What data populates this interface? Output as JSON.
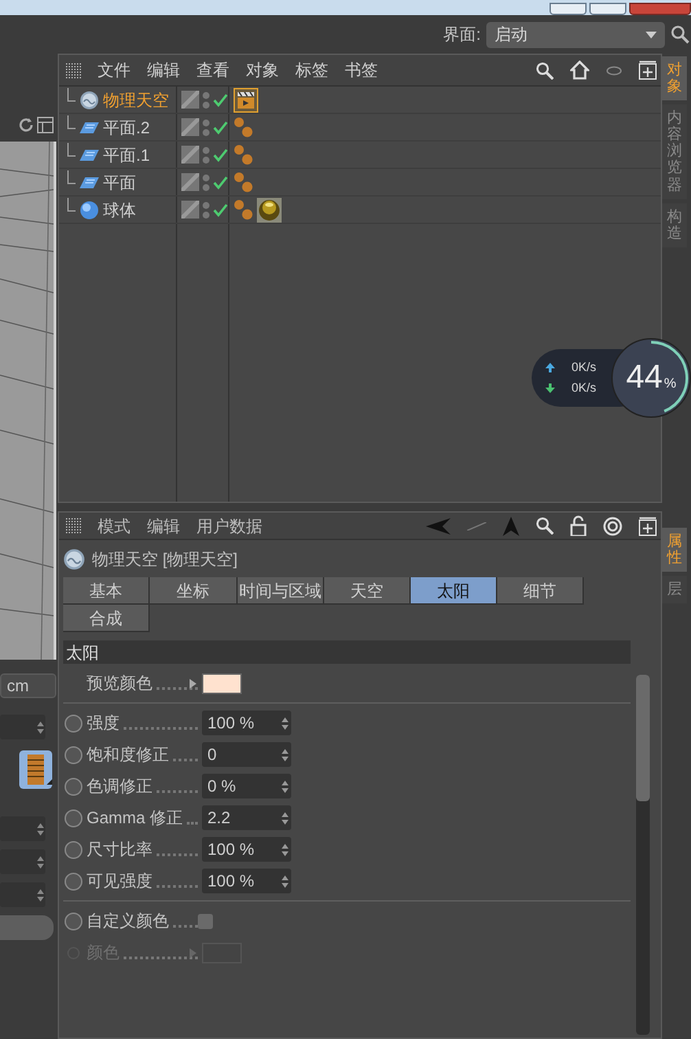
{
  "interface": {
    "label": "界面:",
    "value": "启动"
  },
  "left_panel": {
    "unit": "cm"
  },
  "object_manager": {
    "menu": [
      "文件",
      "编辑",
      "查看",
      "对象",
      "标签",
      "书签"
    ],
    "objects": [
      {
        "name": "物理天空",
        "kind": "sky",
        "selected": true,
        "enabled": true,
        "tags": [
          {
            "kind": "clapper"
          }
        ]
      },
      {
        "name": "平面.2",
        "kind": "plane",
        "selected": false,
        "enabled": true,
        "tags": [
          {
            "kind": "phong"
          }
        ]
      },
      {
        "name": "平面.1",
        "kind": "plane",
        "selected": false,
        "enabled": true,
        "tags": [
          {
            "kind": "phong"
          }
        ]
      },
      {
        "name": "平面",
        "kind": "plane",
        "selected": false,
        "enabled": true,
        "tags": [
          {
            "kind": "phong"
          }
        ]
      },
      {
        "name": "球体",
        "kind": "sphere",
        "selected": false,
        "enabled": true,
        "tags": [
          {
            "kind": "phong"
          },
          {
            "kind": "material"
          }
        ]
      }
    ]
  },
  "side_tabs_top": [
    {
      "label": "对象",
      "selected": true
    },
    {
      "label": "内容浏览器",
      "selected": false
    },
    {
      "label": "构造",
      "selected": false
    }
  ],
  "side_tabs_bottom": [
    {
      "label": "属性",
      "selected": true
    },
    {
      "label": "层",
      "selected": false
    }
  ],
  "speed_meter": {
    "upload": "0K/s",
    "download": "0K/s",
    "percent": "44",
    "unit": "%",
    "level": 0.44
  },
  "attributes": {
    "menu": [
      "模式",
      "编辑",
      "用户数据"
    ],
    "title": "物理天空 [物理天空]",
    "tabs": [
      {
        "label": "基本",
        "selected": false
      },
      {
        "label": "坐标",
        "selected": false
      },
      {
        "label": "时间与区域",
        "selected": false
      },
      {
        "label": "天空",
        "selected": false
      },
      {
        "label": "太阳",
        "selected": true
      },
      {
        "label": "细节",
        "selected": false
      },
      {
        "label": "合成",
        "selected": false
      }
    ],
    "section": "太阳",
    "groups": [
      [
        {
          "kind": "color",
          "label": "预览颜色",
          "color": "#ffe2cf"
        }
      ],
      [
        {
          "kind": "number",
          "label": "强度",
          "value": "100 %",
          "animated": false
        },
        {
          "kind": "number",
          "label": "饱和度修正",
          "value": "0",
          "animated": false
        },
        {
          "kind": "number",
          "label": "色调修正",
          "value": "0 %",
          "animated": false
        },
        {
          "kind": "number",
          "label": "Gamma 修正",
          "value": "2.2",
          "animated": false
        },
        {
          "kind": "number",
          "label": "尺寸比率",
          "value": "100 %",
          "animated": false
        },
        {
          "kind": "number",
          "label": "可见强度",
          "value": "100 %",
          "animated": false
        }
      ],
      [
        {
          "kind": "checkbox",
          "label": "自定义颜色",
          "checked": false,
          "animated": false
        },
        {
          "kind": "color",
          "label": "颜色",
          "disabled": true,
          "animated": false
        }
      ]
    ]
  }
}
